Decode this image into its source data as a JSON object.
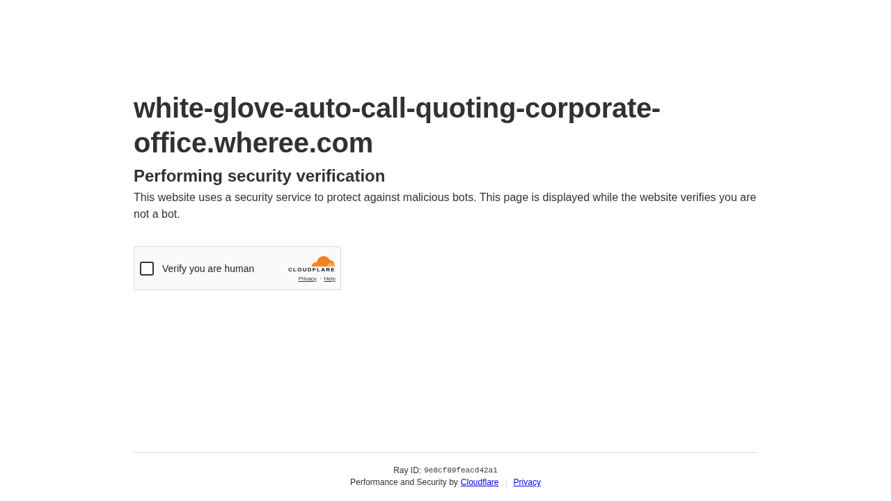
{
  "heading": "white-glove-auto-call-quoting-corporate-office.wheree.com",
  "subheading": "Performing security verification",
  "description": "This website uses a security service to protect against malicious bots. This page is displayed while the website verifies you are not a bot.",
  "widget": {
    "checkbox": {
      "label": "Verify you are human",
      "checked": false
    },
    "brand": "CLOUDFLARE",
    "links": [
      "Privacy",
      "Help"
    ],
    "link_separator": "·"
  },
  "footer": {
    "ray_label": "Ray ID:",
    "ray_id": "9e8cf89feacd42a1",
    "credit": "Performance and Security by",
    "links": [
      "Cloudflare",
      "Privacy"
    ]
  }
}
